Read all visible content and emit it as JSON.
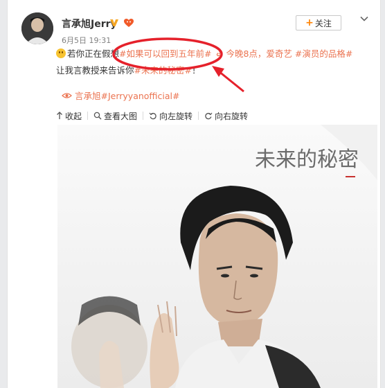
{
  "author": {
    "name": "言承旭Jerry",
    "verified_icon": "verified-v-icon",
    "member_icon": "weibo-member-icon",
    "avatar_icon": "user-avatar"
  },
  "post": {
    "timestamp": "6月5日 19:31",
    "text_part1": "若你正在假想",
    "hashtag1": "#如果可以回到五年前#",
    "link_text": "今晚8点，爱奇艺",
    "hashtag2": "#演员的品格#",
    "text_part2": "让我言教授来告诉你",
    "hashtag3": "#未来的秘密#",
    "text_part3": "！",
    "topic": "言承旭#Jerryyanofficial#",
    "emoji_icon": "tongue-emoji",
    "link_icon": "link-icon",
    "topic_icon": "eye-icon"
  },
  "follow_button": {
    "plus": "+",
    "label": "关注"
  },
  "more_icon": "chevron-down-icon",
  "toolbar": {
    "collapse_label": "收起",
    "view_large_label": "查看大图",
    "rotate_left_label": "向左旋转",
    "rotate_right_label": "向右旋转"
  },
  "image": {
    "watermark_text": "未来的秘密"
  },
  "colors": {
    "link": "#eb7350",
    "accent_orange": "#ff8200",
    "annotation_red": "#e5212b"
  }
}
